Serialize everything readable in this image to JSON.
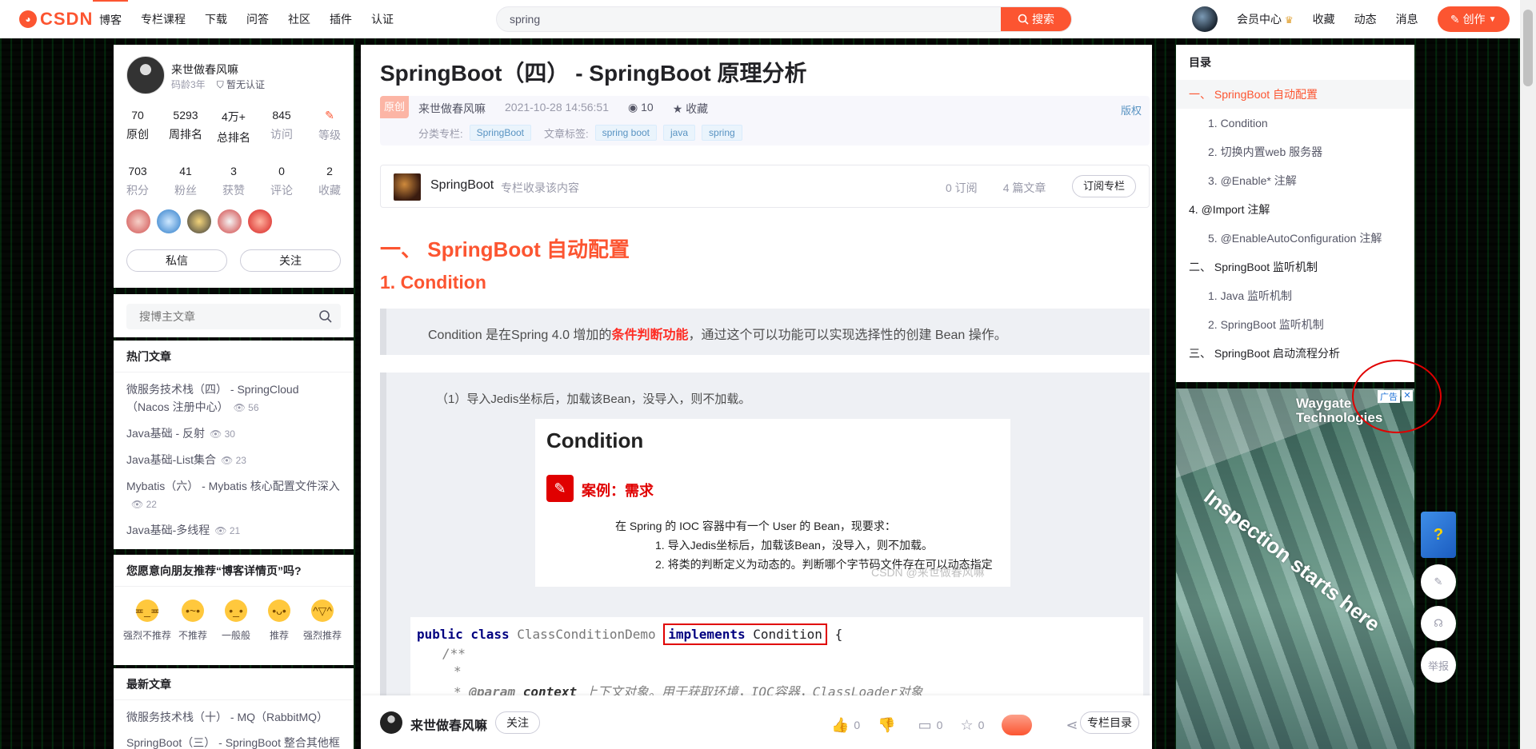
{
  "header": {
    "logo_text": "CSDN",
    "nav": [
      "博客",
      "专栏课程",
      "下载",
      "问答",
      "社区",
      "插件",
      "认证"
    ],
    "search_value": "spring",
    "search_button": "搜索",
    "right_links": [
      "会员中心",
      "收藏",
      "动态",
      "消息"
    ],
    "create_button": "创作",
    "accent_color": "#fc5531"
  },
  "profile": {
    "name": "来世做春风嘛",
    "code_age": "码龄3年",
    "cert": "暂无认证",
    "stats_row1": [
      {
        "num": "70",
        "label": "原创"
      },
      {
        "num": "5293",
        "label": "周排名"
      },
      {
        "num": "4万+",
        "label": "总排名"
      },
      {
        "num": "845",
        "label": "访问"
      },
      {
        "num": "",
        "label": "等级"
      }
    ],
    "stats_row2": [
      {
        "num": "703",
        "label": "积分"
      },
      {
        "num": "41",
        "label": "粉丝"
      },
      {
        "num": "3",
        "label": "获赞"
      },
      {
        "num": "0",
        "label": "评论"
      },
      {
        "num": "2",
        "label": "收藏"
      }
    ],
    "message_button": "私信",
    "follow_button": "关注"
  },
  "blog_search": {
    "placeholder": "搜博主文章"
  },
  "hot_articles": {
    "title": "热门文章",
    "items": [
      {
        "title": "微服务技术栈（四） - SpringCloud（Nacos 注册中心）",
        "views": "56"
      },
      {
        "title": "Java基础 - 反射",
        "views": "30"
      },
      {
        "title": "Java基础-List集合",
        "views": "23"
      },
      {
        "title": "Mybatis（六） - Mybatis 核心配置文件深入",
        "views": "22"
      },
      {
        "title": "Java基础-多线程",
        "views": "21"
      }
    ]
  },
  "recommend": {
    "title": "您愿意向朋友推荐“博客详情页”吗?",
    "options": [
      "强烈不推荐",
      "不推荐",
      "一般般",
      "推荐",
      "强烈推荐"
    ]
  },
  "newest": {
    "title": "最新文章",
    "items": [
      "微服务技术栈（十） - MQ（RabbitMQ）",
      "SpringBoot（三） - SpringBoot 整合其他框"
    ]
  },
  "article": {
    "title": "SpringBoot（四） - SpringBoot 原理分析",
    "original_tag": "原创",
    "author": "来世做春风嘛",
    "date": "2021-10-28 14:56:51",
    "views": "10",
    "favorite": "收藏",
    "copyright": "版权",
    "category_label": "分类专栏:",
    "category": "SpringBoot",
    "tags_label": "文章标签:",
    "tags": [
      "spring boot",
      "java",
      "spring"
    ],
    "column": {
      "name": "SpringBoot",
      "sub": "专栏收录该内容",
      "subscribers": "0 订阅",
      "articles": "4 篇文章",
      "subscribe_button": "订阅专栏"
    },
    "h1": "一、 SpringBoot 自动配置",
    "h2": "1. Condition",
    "quote_before": "Condition 是在Spring 4.0 增加的",
    "quote_highlight": "条件判断功能",
    "quote_after": "，通过这个可以功能可以实现选择性的创建 Bean 操作。",
    "step_text": "（1）导入Jedis坐标后，加载该Bean，没导入，则不加载。",
    "image": {
      "title": "Condition",
      "case_title": "案例：需求",
      "lead": "在 Spring 的 IOC 容器中有一个 User 的 Bean，现要求：",
      "req1": "1. 导入Jedis坐标后，加载该Bean，没导入，则不加载。",
      "req2": "2. 将类的判断定义为动态的。判断哪个字节码文件存在可以动态指定",
      "watermark": "CSDN @来世做春风嘛"
    },
    "code": {
      "kw1": "public class",
      "classname": "ClassConditionDemo",
      "implements": "implements",
      "iface": "Condition",
      "brace": "{",
      "c1": "/**",
      "c2": "*",
      "c3_ann": "@param",
      "c3_param": "context",
      "c3_text": "上下文对象。用于获取环境，IOC容器，ClassLoader对象"
    }
  },
  "bottom_toolbar": {
    "author": "来世做春风嘛",
    "follow": "关注",
    "likes": "0",
    "dislikes": "",
    "comments": "0",
    "favorites": "0",
    "toc_button": "专栏目录"
  },
  "toc": {
    "title": "目录",
    "items": [
      {
        "text": "一、 SpringBoot 自动配置",
        "level": 1,
        "active": true
      },
      {
        "text": "1. Condition",
        "level": 2
      },
      {
        "text": "2. 切换内置web 服务器",
        "level": 2
      },
      {
        "text": "3. @Enable* 注解",
        "level": 2
      },
      {
        "text": "4. @Import 注解",
        "level": 1
      },
      {
        "text": "5. @EnableAutoConfiguration 注解",
        "level": 2
      },
      {
        "text": "二、 SpringBoot 监听机制",
        "level": 1
      },
      {
        "text": "1. Java 监听机制",
        "level": 2
      },
      {
        "text": "2. SpringBoot 监听机制",
        "level": 2
      },
      {
        "text": "三、 SpringBoot 启动流程分析",
        "level": 1
      }
    ]
  },
  "ad": {
    "tag": "广告",
    "close": "✕",
    "brand_line1": "Waygate",
    "brand_line2": "Technologies",
    "slogan": "Inspection starts here"
  },
  "float": {
    "report": "举报"
  }
}
